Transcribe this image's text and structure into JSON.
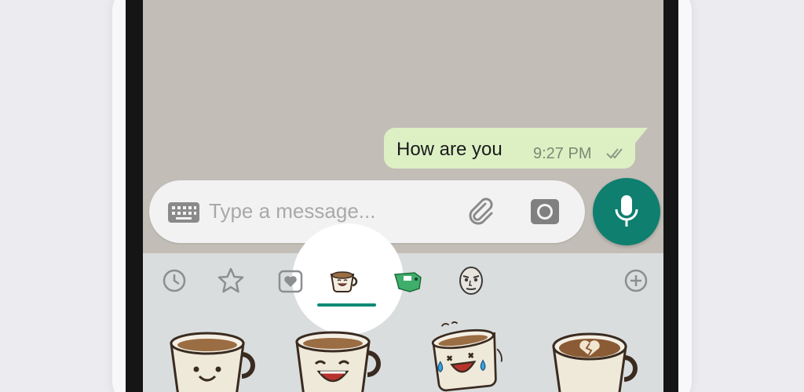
{
  "chat": {
    "message": {
      "text": "How are you",
      "time": "9:27 PM",
      "status_icon": "double-check-icon"
    }
  },
  "composer": {
    "placeholder": "Type a message...",
    "keyboard_icon": "keyboard-icon",
    "attach_icon": "paperclip-icon",
    "camera_icon": "camera-icon",
    "mic_icon": "microphone-icon"
  },
  "sticker_panel": {
    "tabs": [
      {
        "name": "recent",
        "icon": "clock-icon"
      },
      {
        "name": "favorites",
        "icon": "star-icon"
      },
      {
        "name": "loved",
        "icon": "heart-icon"
      },
      {
        "name": "coffee-pack",
        "icon": "coffee-cup-icon",
        "active": true
      },
      {
        "name": "dinosaur-pack",
        "icon": "dinosaur-icon"
      },
      {
        "name": "face-pack",
        "icon": "face-icon"
      },
      {
        "name": "add-pack",
        "icon": "plus-circle-icon"
      }
    ],
    "stickers": [
      "smiling-coffee-cup",
      "laughing-coffee-cup",
      "crying-laughing-coffee-cup",
      "heartbreak-latte-cup"
    ]
  },
  "colors": {
    "chat_background": "#c2bdb7",
    "outgoing_bubble": "#dcf0c4",
    "accent": "#0f7f6f",
    "panel_background": "#dadddd"
  }
}
